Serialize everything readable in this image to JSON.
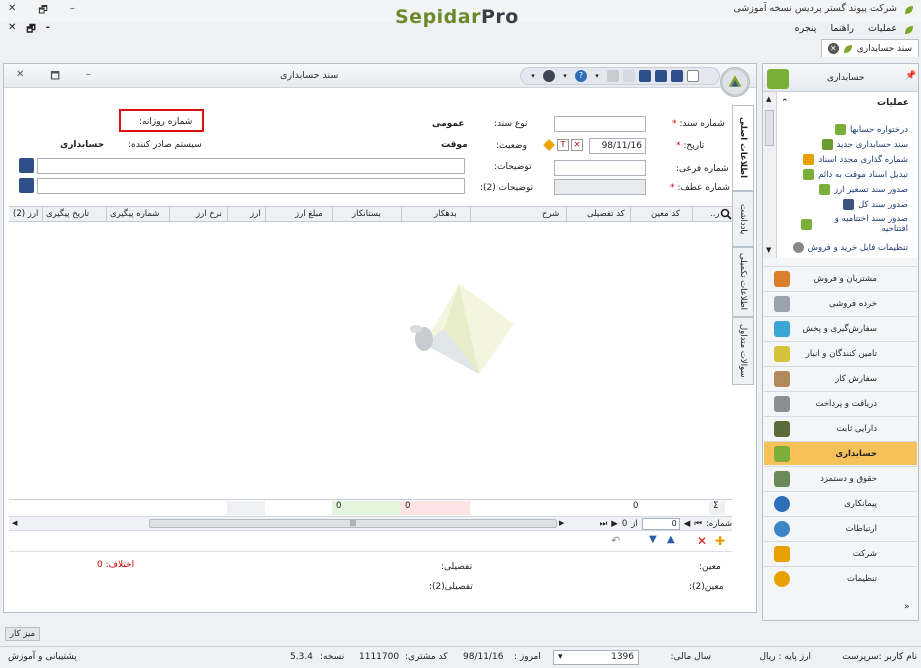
{
  "app": {
    "brand_main": "Sepidar",
    "brand_suffix": "Pro",
    "company_title": "شرکت پیوند گستر پردیس نسخه آموزشی",
    "win_min": "–",
    "win_restore": "🗗",
    "win_close": "✕"
  },
  "menu": {
    "items": [
      "عملیات",
      "راهنما",
      "پنجره"
    ],
    "mdi_close": "✕",
    "mdi_restore": "🗗",
    "mdi_min": "-"
  },
  "tab": {
    "label": "سند حسابداری"
  },
  "document": {
    "title": "سند حسابداری",
    "vtabs": [
      "اطلاعات اصلی",
      "یادداشت",
      "اطلاعات تکمیلی",
      "سوالات متداول"
    ],
    "fields": {
      "voucher_no_label": "شماره سند:",
      "voucher_type_label": "نوع سند:",
      "voucher_type_value": "عمومی",
      "daily_no_label": "شماره روزانه:",
      "date_label": "تاریخ:",
      "date_value": "98/11/16",
      "status_label": "وضعیت:",
      "status_value": "موقت",
      "issuer_label": "سیستم صادر کننده:",
      "issuer_value": "حسابداری",
      "sub_no_label": "شماره فرعی:",
      "desc_label": "توضیحات:",
      "ref_no_label": "شماره عطف:",
      "desc2_label": "توضیحات (2):"
    },
    "grid": {
      "columns": [
        "ر..",
        "کد معین",
        "کد تفصیلی",
        "شرح",
        "بدهکار",
        "بستانکار",
        "مبلغ ارز",
        "ارز",
        "نرخ ارز",
        "شماره پیگیری",
        "تاریخ پیگیری",
        "ارز (2)"
      ],
      "sums": {
        "count": "0",
        "debit": "0",
        "credit": "0"
      },
      "nav_record_label": "شماره:",
      "nav_from_label": "از",
      "nav_current": "0",
      "nav_total": "0"
    },
    "footer": {
      "moein_label": "معین:",
      "tafsili_label": "تفصیلی:",
      "moein2_label": "معین(2):",
      "tafsili2_label": "تفصیلی(2):",
      "diff_label": "اختلاف:",
      "diff_value": "0"
    }
  },
  "right_panel": {
    "header": "حسابداری",
    "ops_title": "عملیات",
    "ops": [
      "درختواره حسابها",
      "سند حسابداری جدید",
      "شماره گذاری مجدد اسناد",
      "تبدیل اسناد موقت به دائم",
      "صدور سند تسعیر ارز",
      "صدور سند کل",
      "صدور سند اختتامیه و افتتاحیه",
      "تنظیمات فایل خرید و فروش"
    ],
    "nav": [
      "مشتریان و فروش",
      "خرده فروشی",
      "سفارش‌گیری و پخش",
      "تامین کنندگان و انبار",
      "سفارش کار",
      "دریافت و پرداخت",
      "دارایی ثابت",
      "حسابداری",
      "حقوق و دستمزد",
      "پیمانکاری",
      "ارتباطات",
      "شرکت",
      "تنظیمات"
    ],
    "active_nav": "حسابداری"
  },
  "statusbar": {
    "desk": "میز کار",
    "user": "نام کاربر :سرپرست",
    "base_currency": "ارز پایه : ریال",
    "fiscal_year_label": "سال مالی:",
    "fiscal_year": "1396",
    "today_label": "امروز :",
    "today": "98/11/16",
    "customer_code_label": "کد مشتری:",
    "customer_code": "1111700",
    "version_label": "نسخه:",
    "version": "5.3.4",
    "support": "پشتیبانی و آموزش"
  },
  "colors": {
    "accent": "#f7c15a",
    "brand_green": "#6d8a2a",
    "required": "#cc0000",
    "highlight_box": "#dd1111"
  }
}
